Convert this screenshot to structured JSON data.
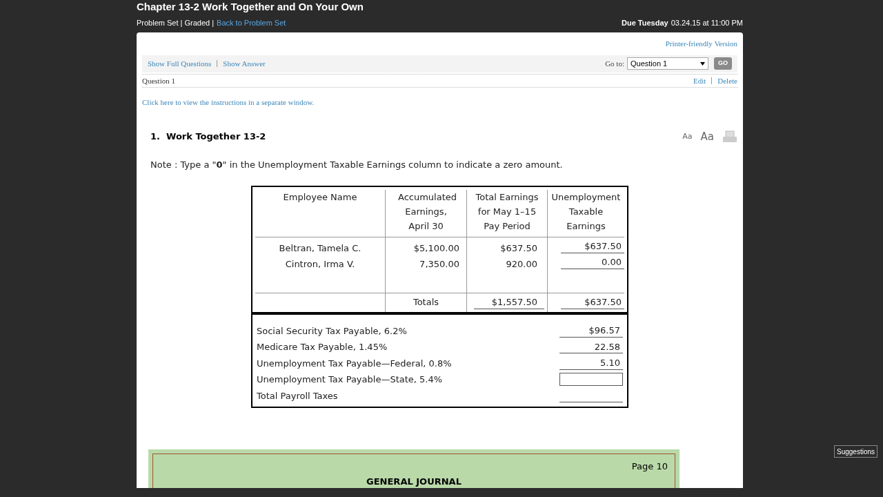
{
  "page_title": "Chapter 13-2 Work Together and On Your Own",
  "subtitle": {
    "text": "Problem Set | Graded |",
    "link": "Back to Problem Set"
  },
  "due": {
    "label": "Due Tuesday",
    "date": "03.24.15 at 11:00 PM"
  },
  "printer_link": "Printer-friendly Version",
  "toolbar": {
    "links": [
      "Show Full Questions",
      "Show Answer"
    ],
    "goto_label": "Go to:",
    "goto_value": "Question 1",
    "go_button": "GO"
  },
  "question_bar": {
    "label": "Question 1",
    "actions": [
      "Edit",
      "Delete"
    ]
  },
  "instructions_link": "Click here to view the instructions in a separate window.",
  "question": {
    "title": "1.  Work Together 13-2",
    "font_buttons": [
      "Aa",
      "Aa"
    ],
    "note": "Note : Type a \"**0**\" in the Unemployment Taxable Earnings column to indicate a zero amount."
  },
  "table": {
    "columns": [
      "Employee Name",
      "Accumulated Earnings, April 30",
      "Total Earnings for May 1–15 Pay Period",
      "Unemployment Taxable Earnings"
    ],
    "rows": [
      {
        "name": "Beltran, Tamela C.",
        "accumulated": "$5,100.00",
        "total": "$637.50",
        "taxable": "$637.50"
      },
      {
        "name": "Cintron, Irma V.",
        "accumulated": "7,350.00",
        "total": "920.00",
        "taxable": "0.00"
      }
    ],
    "totals": {
      "label": "Totals",
      "total": "$1,557.50",
      "taxable": "$637.50"
    }
  },
  "taxes": [
    {
      "label": "Social Security Tax Payable, 6.2%",
      "kind": "answer",
      "value": "$96.57"
    },
    {
      "label": "Medicare Tax Payable, 1.45%",
      "kind": "answer",
      "value": "22.58"
    },
    {
      "label": "Unemployment Tax Payable—Federal, 0.8%",
      "kind": "answer",
      "value": "5.10"
    },
    {
      "label": "Unemployment Tax Payable—State, 5.4%",
      "kind": "input"
    },
    {
      "label": "Total Payroll Taxes",
      "kind": "answer"
    }
  ],
  "journal": {
    "page": "Page 10",
    "title": "GENERAL JOURNAL"
  },
  "suggestions_button": "Suggestions"
}
